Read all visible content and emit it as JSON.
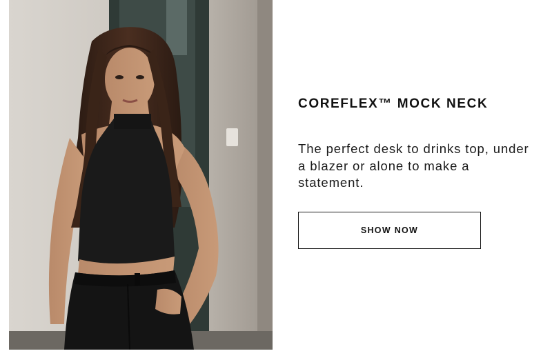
{
  "product": {
    "title": "COREFLEX™ MOCK NECK",
    "description": "The perfect desk to drinks top, under a blazer or alone to make a statement.",
    "cta_label": "SHOW NOW"
  },
  "colors": {
    "text": "#111111",
    "border": "#1a1a1a",
    "background": "#ffffff"
  }
}
